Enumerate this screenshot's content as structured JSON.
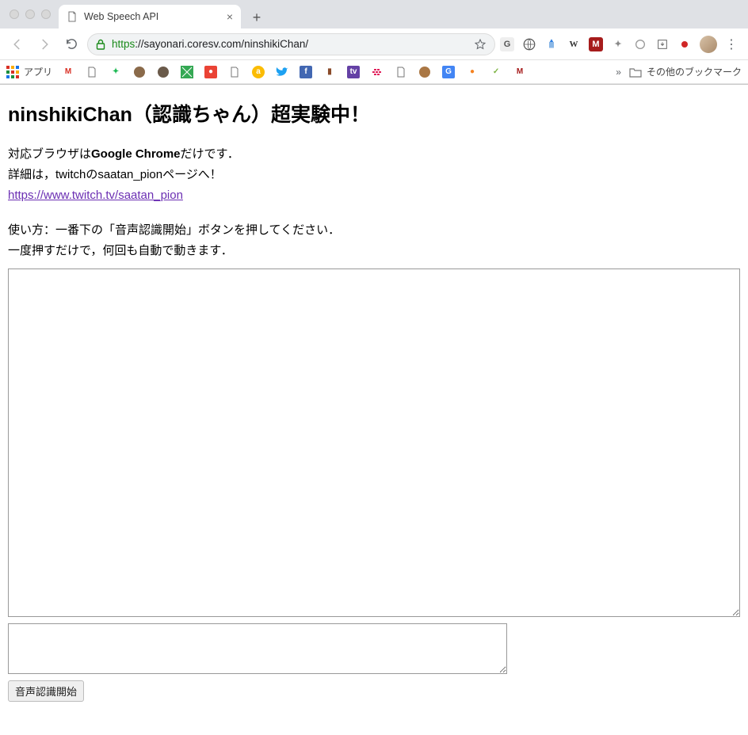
{
  "browser": {
    "tab_title": "Web Speech API",
    "url_secure_prefix": "https",
    "url_rest": "://sayonari.coresv.com/ninshikiChan/",
    "apps_label": "アプリ",
    "overflow_label": "その他のブックマーク"
  },
  "page": {
    "heading": "ninshikiChan（認識ちゃん）超実験中！",
    "line1_prefix": "対応ブラウザは",
    "line1_bold": "Google Chrome",
    "line1_suffix": "だけです．",
    "line2": "詳細は，twitchのsaatan_pionページへ！",
    "link_text": "https://www.twitch.tv/saatan_pion",
    "usage1": "使い方：一番下の「音声認識開始」ボタンを押してください．",
    "usage2": "一度押すだけで，何回も自動で動きます．",
    "textarea_big_value": "",
    "textarea_small_value": "",
    "start_button": "音声認識開始"
  }
}
